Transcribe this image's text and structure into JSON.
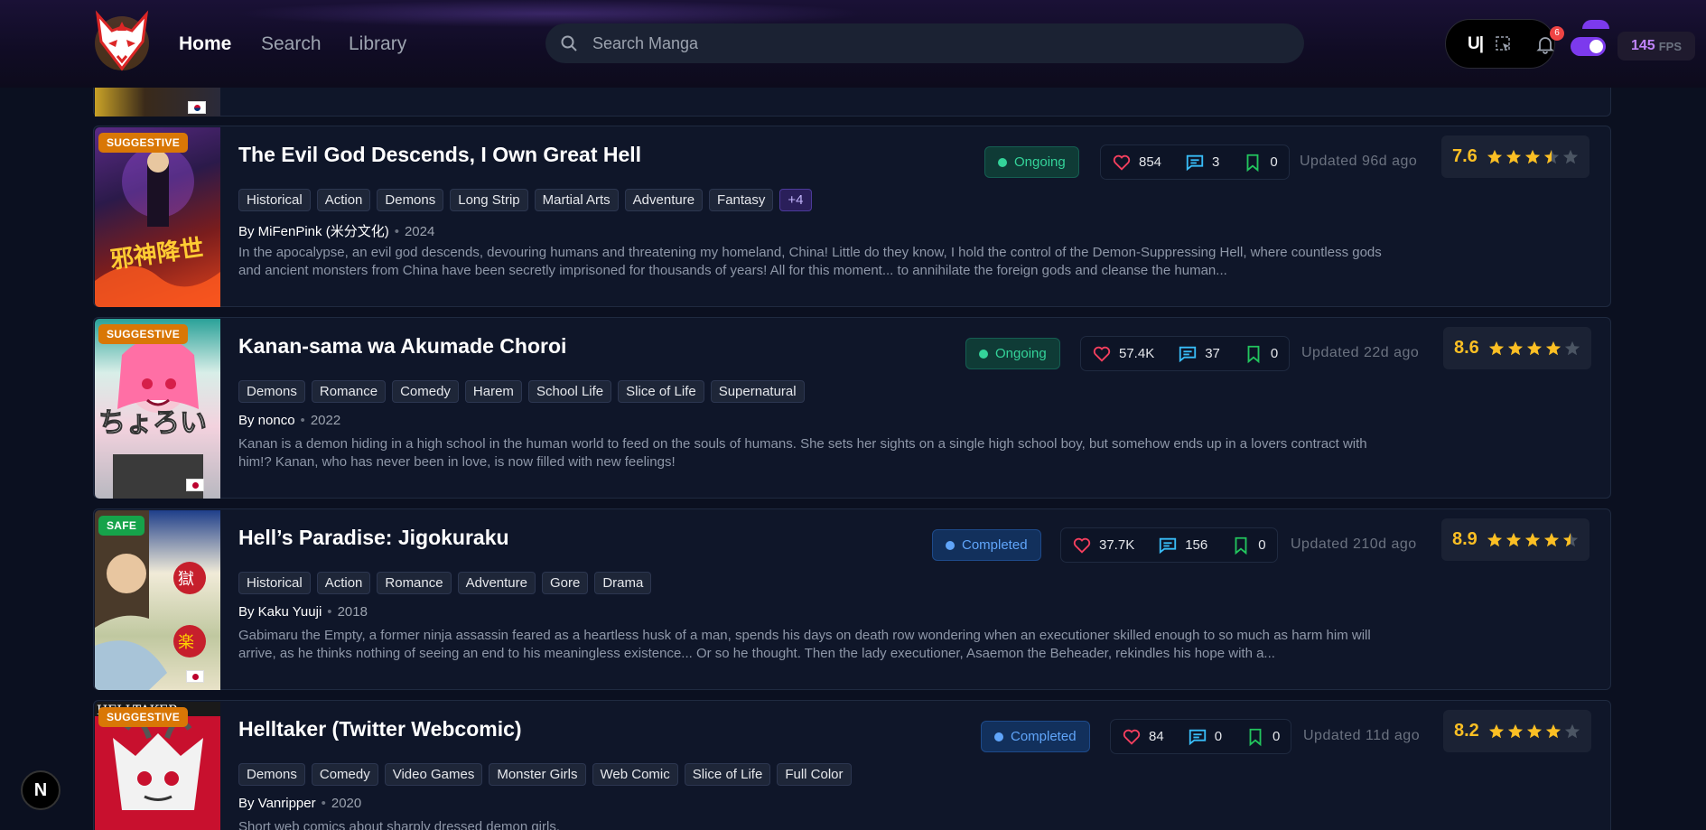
{
  "nav": {
    "home": "Home",
    "search": "Search",
    "library": "Library"
  },
  "search": {
    "placeholder": "Search Manga"
  },
  "tools": {
    "u_label": "U|"
  },
  "notifications": {
    "count": "6"
  },
  "fps": {
    "value": "145",
    "label": "FPS"
  },
  "dev": {
    "n_label": "N"
  },
  "colors": {
    "accent": "#7c3aed",
    "star": "#fbbf24",
    "suggestive": "#d97706",
    "safe": "#16a34a"
  },
  "cards": [
    {
      "badge": "SUGGESTIVE",
      "title": "The Evil God Descends, I Own Great Hell",
      "status": "Ongoing",
      "likes": "854",
      "comments": "3",
      "bookmarks": "0",
      "updated": "Updated 96d ago",
      "rating": "7.6",
      "stars": 3.5,
      "tags": [
        "Historical",
        "Action",
        "Demons",
        "Long Strip",
        "Martial Arts",
        "Adventure",
        "Fantasy",
        "+4"
      ],
      "author": "By MiFenPink (米分文化)",
      "year": "2024",
      "description": "In the apocalypse, an evil god descends, devouring humans and threatening my homeland, China! Little do they know, I hold the control of the Demon-Suppressing Hell, where countless gods and ancient monsters from China have been secretly imprisoned for thousands of years! All for this moment... to annihilate the foreign gods and cleanse the human...",
      "flag": "cn"
    },
    {
      "badge": "SUGGESTIVE",
      "title": "Kanan-sama wa Akumade Choroi",
      "status": "Ongoing",
      "likes": "57.4K",
      "comments": "37",
      "bookmarks": "0",
      "updated": "Updated 22d ago",
      "rating": "8.6",
      "stars": 4,
      "tags": [
        "Demons",
        "Romance",
        "Comedy",
        "Harem",
        "School Life",
        "Slice of Life",
        "Supernatural"
      ],
      "author": "By nonco",
      "year": "2022",
      "description": "Kanan is a demon hiding in a high school in the human world to feed on the souls of humans. She sets her sights on a single high school boy, but somehow ends up in a lovers contract with him!? Kanan, who has never been in love, is now filled with new feelings!",
      "flag": "jp"
    },
    {
      "badge": "SAFE",
      "title": "Hell’s Paradise: Jigokuraku",
      "status": "Completed",
      "likes": "37.7K",
      "comments": "156",
      "bookmarks": "0",
      "updated": "Updated 210d ago",
      "rating": "8.9",
      "stars": 4.5,
      "tags": [
        "Historical",
        "Action",
        "Romance",
        "Adventure",
        "Gore",
        "Drama"
      ],
      "author": "By Kaku Yuuji",
      "year": "2018",
      "description": "Gabimaru the Empty, a former ninja assassin feared as a heartless husk of a man, spends his days on death row wondering when an executioner skilled enough to so much as harm him will arrive, as he thinks nothing of seeing an end to his meaningless existence... Or so he thought. Then the lady executioner, Asaemon the Beheader, rekindles his hope with a...",
      "flag": "jp"
    },
    {
      "badge": "SUGGESTIVE",
      "title": "Helltaker (Twitter Webcomic)",
      "status": "Completed",
      "likes": "84",
      "comments": "0",
      "bookmarks": "0",
      "updated": "Updated 11d ago",
      "rating": "8.2",
      "stars": 4,
      "tags": [
        "Demons",
        "Comedy",
        "Video Games",
        "Monster Girls",
        "Web Comic",
        "Slice of Life",
        "Full Color"
      ],
      "author": "By Vanripper",
      "year": "2020",
      "description": "Short web comics about sharply dressed demon girls.",
      "cover_text": "HELLTAKER",
      "flag": "none"
    }
  ]
}
